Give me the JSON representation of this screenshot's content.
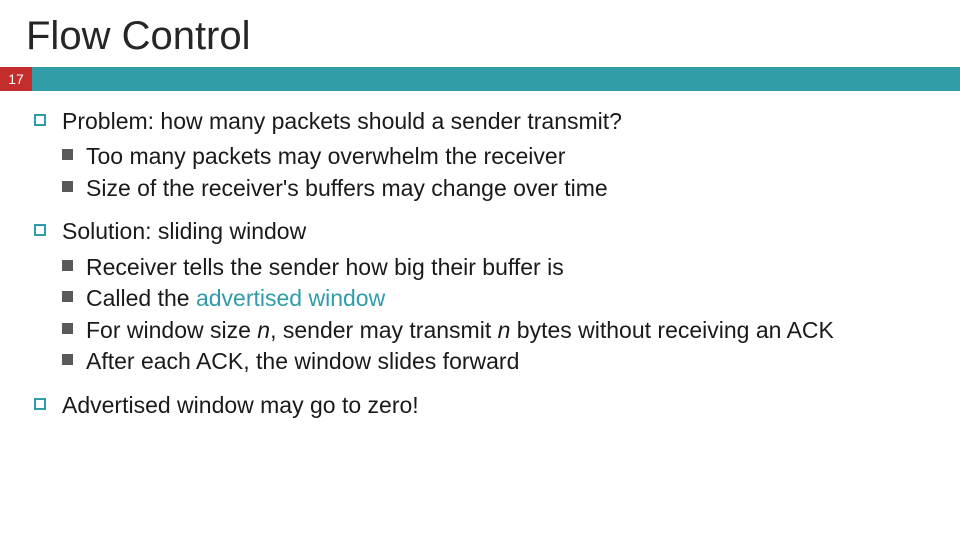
{
  "title": "Flow Control",
  "slide_number": "17",
  "bullets": {
    "b1": "Problem: how many packets should a sender transmit?",
    "b1s1": "Too many packets may overwhelm the receiver",
    "b1s2": "Size of the receiver's buffers may change over time",
    "b2": "Solution: sliding window",
    "b2s1": "Receiver tells the sender how big their buffer is",
    "b2s2a": "Called the ",
    "b2s2b": "advertised window",
    "b2s3a": "For window size ",
    "b2s3n1": "n",
    "b2s3b": ", sender may transmit ",
    "b2s3n2": "n",
    "b2s3c": " bytes without receiving an ACK",
    "b2s4": "After each ACK, the window slides forward",
    "b3": "Advertised window may go to zero!"
  }
}
